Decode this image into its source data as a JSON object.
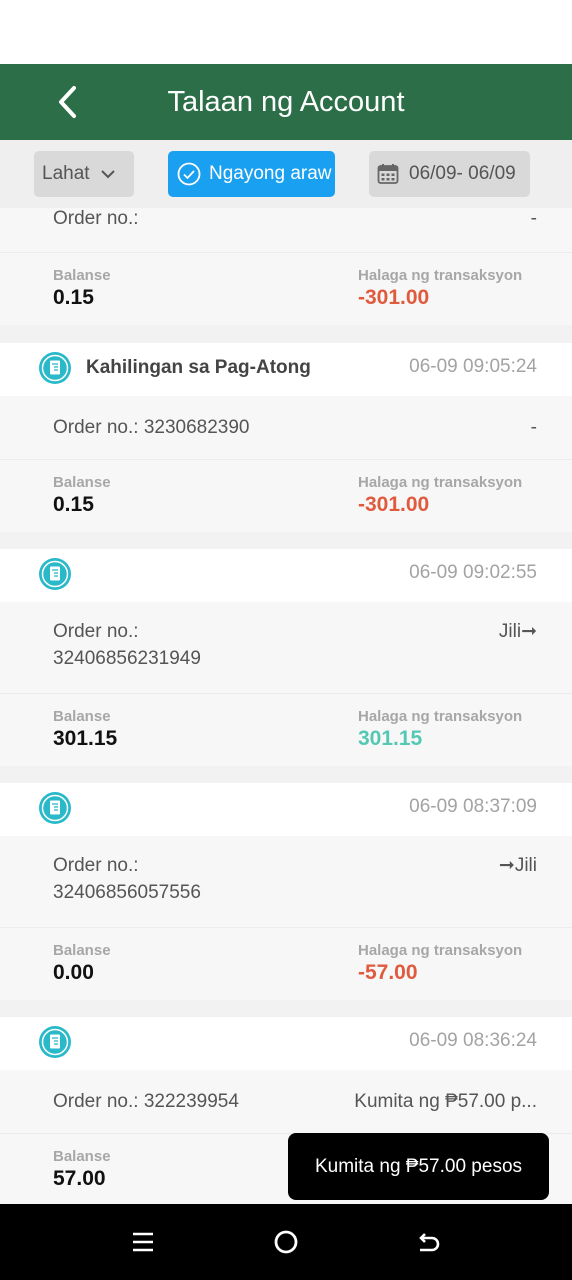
{
  "header": {
    "title": "Talaan ng Account"
  },
  "filters": {
    "type_label": "Lahat",
    "today_label": "Ngayong araw",
    "date_range": "06/09- 06/09"
  },
  "labels": {
    "order_prefix": "Order no.:",
    "balance": "Balanse",
    "amount": "Halaga ng transaksyon"
  },
  "records": [
    {
      "type": "",
      "time": "",
      "order_no": "",
      "right": "-",
      "balance": "0.15",
      "amount": "-301.00",
      "amount_sign": "neg"
    },
    {
      "type": "Kahilingan sa Pag-Atong",
      "time": "06-09 09:05:24",
      "order_no": "3230682390",
      "right": "-",
      "balance": "0.15",
      "amount": "-301.00",
      "amount_sign": "neg"
    },
    {
      "type": "",
      "time": "06-09 09:02:55",
      "order_no": "32406856231949",
      "right": "Jili➞",
      "balance": "301.15",
      "amount": "301.15",
      "amount_sign": "pos"
    },
    {
      "type": "",
      "time": "06-09 08:37:09",
      "order_no": "32406856057556",
      "right": "➞Jili",
      "balance": "0.00",
      "amount": "-57.00",
      "amount_sign": "neg"
    },
    {
      "type": "",
      "time": "06-09 08:36:24",
      "order_no": "322239954",
      "right": "Kumita ng ₱57.00 p...",
      "balance": "57.00",
      "amount": "",
      "amount_sign": "pos"
    }
  ],
  "toast": {
    "message": "Kumita ng ₱57.00 pesos"
  },
  "icons": {
    "back": "chevron-left-icon",
    "dropdown": "chevron-down-icon",
    "check": "check-circle-icon",
    "calendar": "calendar-icon",
    "record": "receipt-icon",
    "nav_menu": "menu-icon",
    "nav_home": "home-icon",
    "nav_back": "back-icon"
  },
  "colors": {
    "header": "#2c6e48",
    "today_active": "#1aa0f0",
    "negative": "#e05a3e",
    "positive": "#55c8b4",
    "icon_teal": "#29b9c9"
  }
}
